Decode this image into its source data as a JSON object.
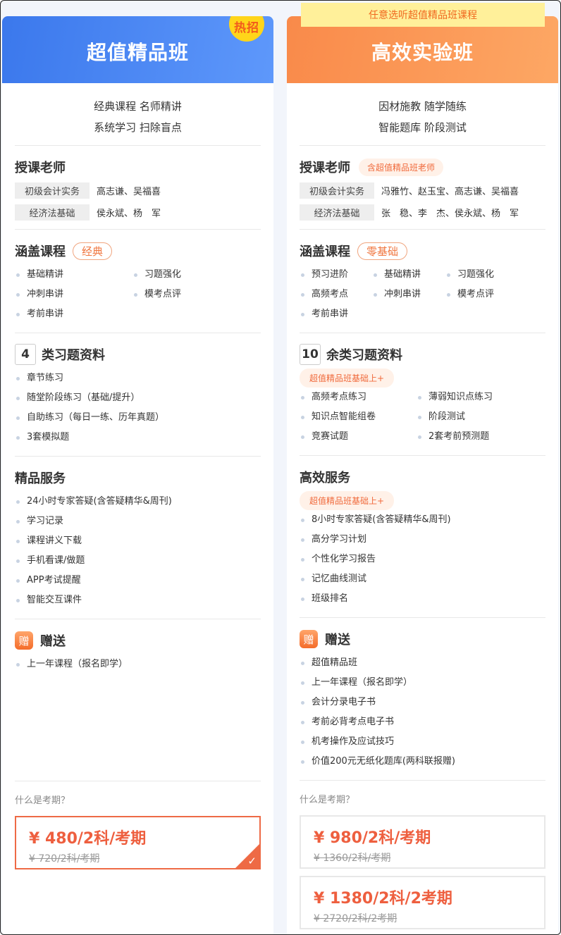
{
  "left": {
    "title": "超值精品班",
    "badge": "热招",
    "slogans": [
      "经典课程 名师精讲",
      "系统学习 扫除盲点"
    ],
    "teachers": {
      "heading": "授课老师",
      "rows": [
        {
          "subject": "初级会计实务",
          "names": "高志谦、吴福喜"
        },
        {
          "subject": "经济法基础",
          "names": "侯永斌、杨　军"
        }
      ]
    },
    "courses": {
      "heading": "涵盖课程",
      "tag": "经典",
      "items": [
        "基础精讲",
        "习题强化",
        "冲刺串讲",
        "模考点评",
        "考前串讲"
      ]
    },
    "exercises": {
      "count": "4",
      "heading": "类习题资料",
      "items": [
        "章节练习",
        "随堂阶段练习（基础/提升）",
        "自助练习（每日一练、历年真题）",
        "3套模拟题"
      ]
    },
    "services": {
      "heading": "精品服务",
      "items": [
        "24小时专家答疑(含答疑精华&周刊)",
        "学习记录",
        "课程讲义下载",
        "手机看课/做题",
        "APP考试提醒",
        "智能交互课件"
      ]
    },
    "gifts": {
      "icon_text": "赠",
      "heading": "赠送",
      "items": [
        "上一年课程（报名即学）"
      ]
    },
    "question": "什么是考期？",
    "prices": [
      {
        "price": "¥ 480/2科/考期",
        "original": "¥ 720/2科/考期",
        "selected": true
      }
    ]
  },
  "right": {
    "title": "高效实验班",
    "ribbon": "任意选听超值精品班课程",
    "slogans": [
      "因材施教 随学随练",
      "智能题库 阶段测试"
    ],
    "teachers": {
      "heading": "授课老师",
      "tag": "含超值精品班老师",
      "rows": [
        {
          "subject": "初级会计实务",
          "names": "冯雅竹、赵玉宝、高志谦、吴福喜"
        },
        {
          "subject": "经济法基础",
          "names": "张　稳、李　杰、侯永斌、杨　军"
        }
      ]
    },
    "courses": {
      "heading": "涵盖课程",
      "tag": "零基础",
      "items": [
        "预习进阶",
        "基础精讲",
        "习题强化",
        "高频考点",
        "冲刺串讲",
        "模考点评",
        "考前串讲"
      ]
    },
    "exercises": {
      "count": "10",
      "heading": "余类习题资料",
      "sub": "超值精品班基础上+",
      "items": [
        "高频考点练习",
        "薄弱知识点练习",
        "知识点智能组卷",
        "阶段测试",
        "竞赛试题",
        "2套考前预测题"
      ]
    },
    "services": {
      "heading": "高效服务",
      "sub": "超值精品班基础上+",
      "items": [
        "8小时专家答疑(含答疑精华&周刊)",
        "高分学习计划",
        "个性化学习报告",
        "记忆曲线测试",
        "班级排名"
      ]
    },
    "gifts": {
      "icon_text": "赠",
      "heading": "赠送",
      "items": [
        "超值精品班",
        "上一年课程（报名即学）",
        "会计分录电子书",
        "考前必背考点电子书",
        "机考操作及应试技巧",
        "价值200元无纸化题库(两科联报赠)"
      ]
    },
    "question": "什么是考期？",
    "prices": [
      {
        "price": "¥ 980/2科/考期",
        "original": "¥ 1360/2科/考期",
        "selected": false
      },
      {
        "price": "¥ 1380/2科/2考期",
        "original": "¥ 2720/2科/2考期",
        "selected": false
      }
    ]
  }
}
